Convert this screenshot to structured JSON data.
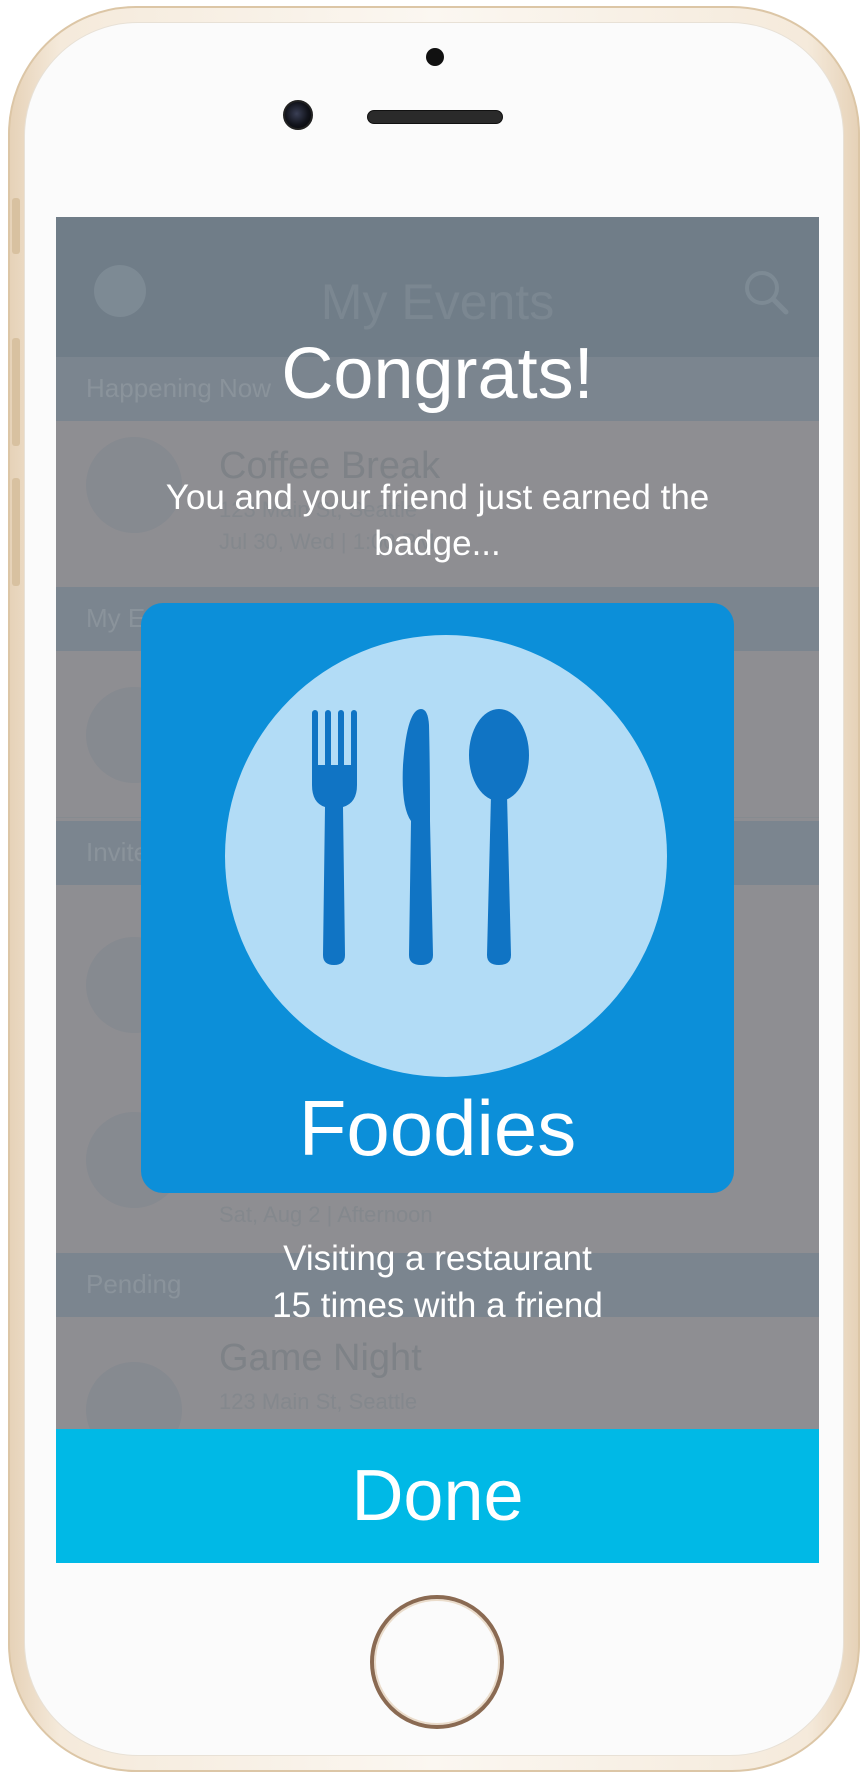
{
  "colors": {
    "screen_dim": "#8e8e92",
    "badge_card": "#0c8fd9",
    "badge_plate": "#b2dcf6",
    "utensil": "#1074c4",
    "done_button": "#00b9e6",
    "text_on_overlay": "#ffffff"
  },
  "background_app": {
    "title": "My Events",
    "logo_icon": "chat-bubble-logo-icon",
    "search_icon": "search-icon",
    "sections": [
      "Happening Now",
      "My Events",
      "Invited",
      "Pending"
    ],
    "rows": [
      {
        "title": "Coffee Break",
        "address": "123 Main St, Seattle",
        "time": "Jul 30, Wed | 1:00 PM"
      },
      {
        "title": "",
        "address": "",
        "time": "Sat, Aug 2 | Afternoon"
      },
      {
        "title": "Game Night",
        "address": "123 Main St, Seattle",
        "time": ""
      }
    ]
  },
  "modal": {
    "title": "Congrats!",
    "subtitle": "You and your friend just earned the badge...",
    "badge": {
      "name": "Foodies",
      "icon": "fork-knife-spoon-icon"
    },
    "description_line1": "Visiting a restaurant",
    "description_line2": "15 times with a friend",
    "done_label": "Done"
  }
}
